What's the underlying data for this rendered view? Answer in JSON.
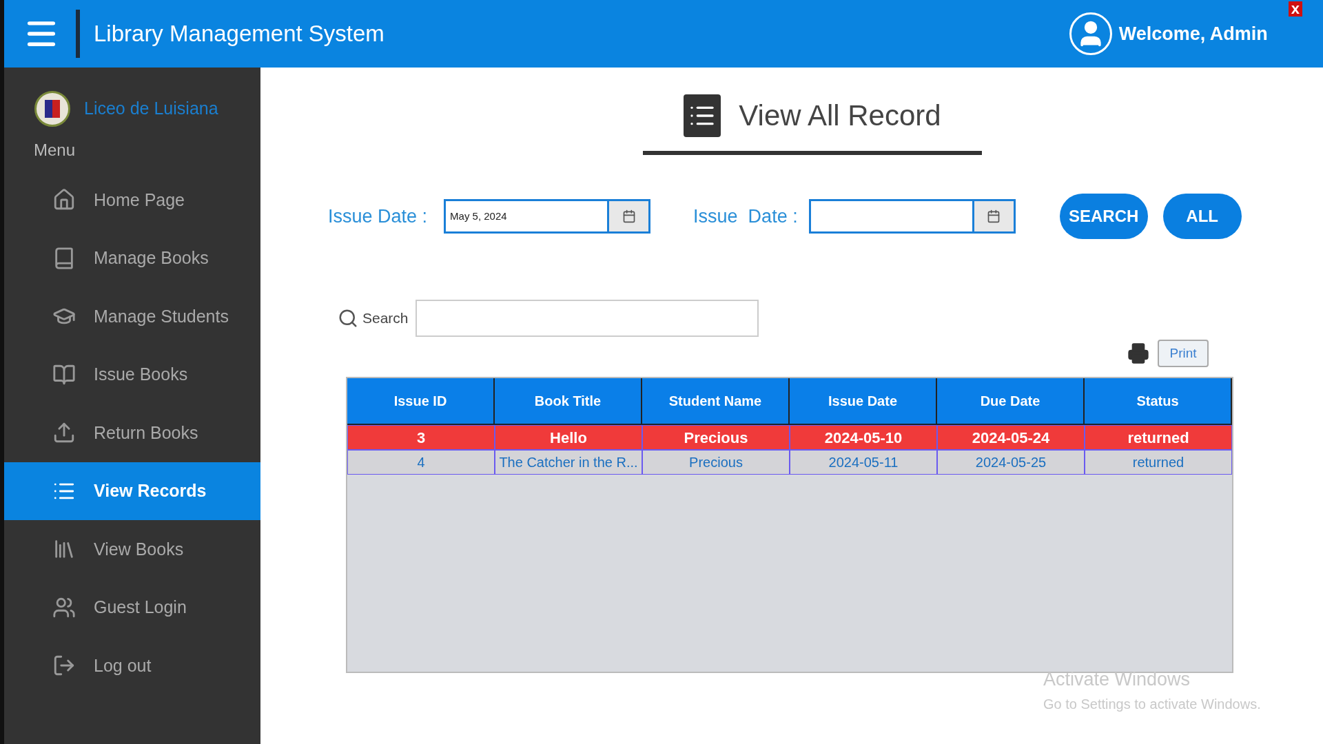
{
  "header": {
    "title": "Library Management System",
    "welcome": "Welcome, Admin",
    "close": "x"
  },
  "sidebar": {
    "brand": "Liceo de Luisiana",
    "section": "Menu",
    "items": [
      {
        "label": "Home Page",
        "selected": false
      },
      {
        "label": "Manage Books",
        "selected": false
      },
      {
        "label": "Manage Students",
        "selected": false
      },
      {
        "label": "Issue Books",
        "selected": false
      },
      {
        "label": "Return Books",
        "selected": false
      },
      {
        "label": "View Records",
        "selected": true
      },
      {
        "label": "View Books",
        "selected": false
      },
      {
        "label": "Guest Login",
        "selected": false
      },
      {
        "label": "Log out",
        "selected": false
      }
    ]
  },
  "page": {
    "title": "View All Record"
  },
  "filters": {
    "from_label": "Issue Date :",
    "from_value": "May 5, 2024",
    "to_label": "Issue  Date :",
    "buttons": [
      "SEARCH",
      "ALL"
    ]
  },
  "search": {
    "label": "Search"
  },
  "print": {
    "label": "Print"
  },
  "table": {
    "columns": [
      "Issue ID",
      "Book Title",
      "Student Name",
      "Issue Date",
      "Due Date",
      "Status"
    ],
    "rows": [
      {
        "cells": [
          "3",
          "Hello",
          "Precious",
          "2024-05-10",
          "2024-05-24",
          "returned"
        ],
        "selected": true
      },
      {
        "cells": [
          "4",
          "The Catcher in the R...",
          "Precious",
          "2024-05-11",
          "2024-05-25",
          "returned"
        ],
        "selected": false
      }
    ]
  },
  "activation": {
    "title": "Activate Windows",
    "text": "Go to Settings to activate Windows."
  }
}
